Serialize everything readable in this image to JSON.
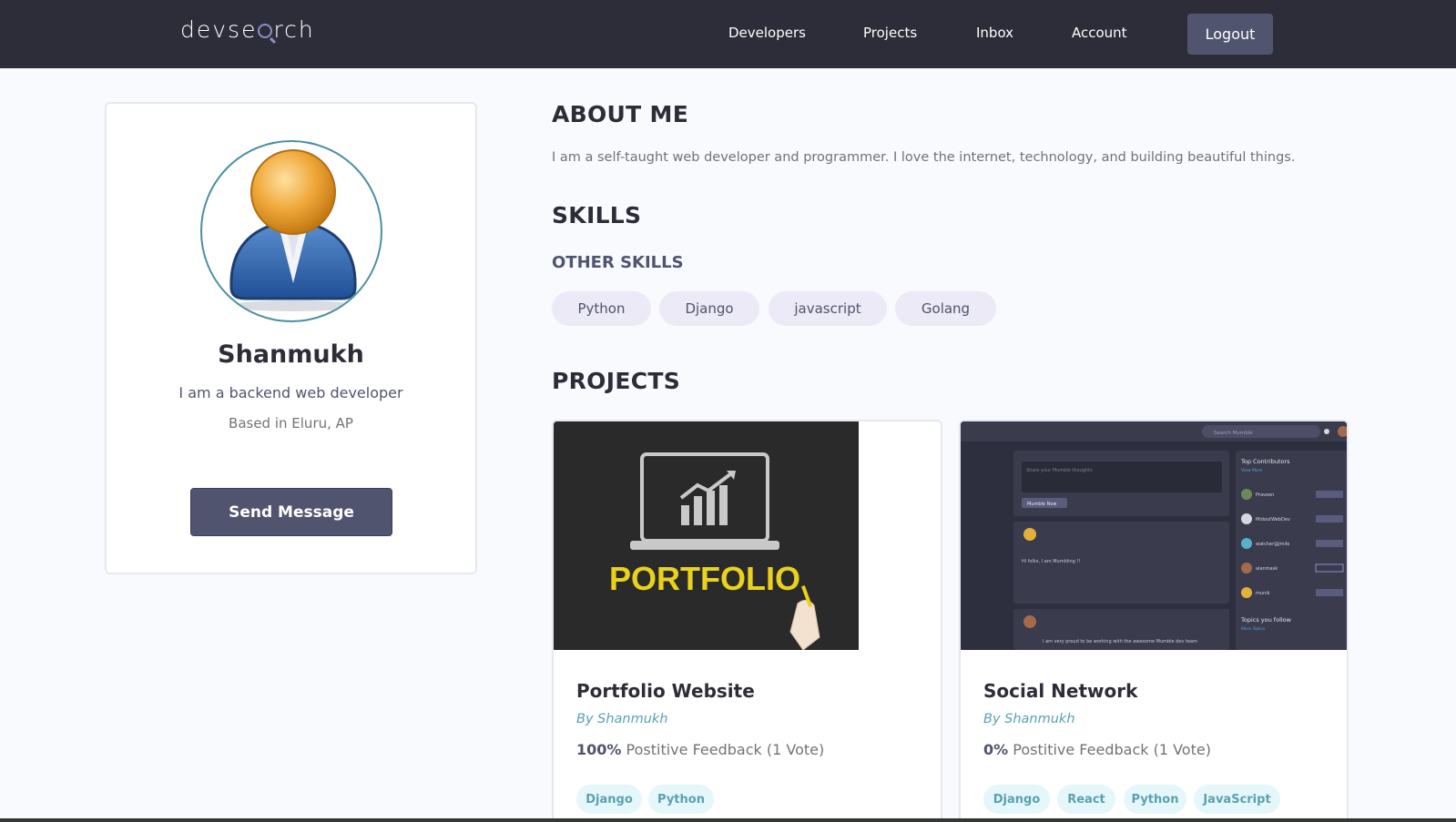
{
  "nav": {
    "logo": "devsearch",
    "links": [
      "Developers",
      "Projects",
      "Inbox",
      "Account"
    ],
    "logout": "Logout"
  },
  "profile": {
    "name": "Shanmukh",
    "headline": "I am a backend web developer",
    "location": "Based in Eluru, AP",
    "send_message": "Send Message"
  },
  "about": {
    "heading": "ABOUT ME",
    "text": "I am a self-taught web developer and programmer. I love the internet, technology, and building beautiful things."
  },
  "skills": {
    "heading": "SKILLS",
    "other_heading": "OTHER SKILLS",
    "items": [
      "Python",
      "Django",
      "javascript",
      "Golang"
    ]
  },
  "projects": {
    "heading": "PROJECTS",
    "items": [
      {
        "title": "Portfolio Website",
        "by": "By Shanmukh",
        "percent": "100%",
        "feedback": "Postitive Feedback (1 Vote)",
        "image_text": "PORTFOLIO",
        "tags": [
          "Django",
          "Python"
        ]
      },
      {
        "title": "Social Network",
        "by": "By Shanmukh",
        "percent": "0%",
        "feedback": "Postitive Feedback (1 Vote)",
        "tags": [
          "Django",
          "React",
          "Python",
          "JavaScript"
        ],
        "screenshot": {
          "search_placeholder": "Search Mumble",
          "post_placeholder": "Share your Mumble thoughts",
          "post_button": "Mumble Now",
          "top_contributors": "Top Contributors",
          "view_more": "View More",
          "contributors": [
            "Praveen",
            "MidoutWebDev",
            "watcher@Jmile",
            "alanmask",
            "munik"
          ],
          "topics": "Topics you follow",
          "more_topics": "More Topics"
        }
      }
    ]
  },
  "colors": {
    "nav_bg": "#2d2d39",
    "accent": "#51546e",
    "tag_text": "#5aa1b0",
    "tag_bg": "#e5f7fa",
    "skill_bg": "#ebeaf6"
  }
}
